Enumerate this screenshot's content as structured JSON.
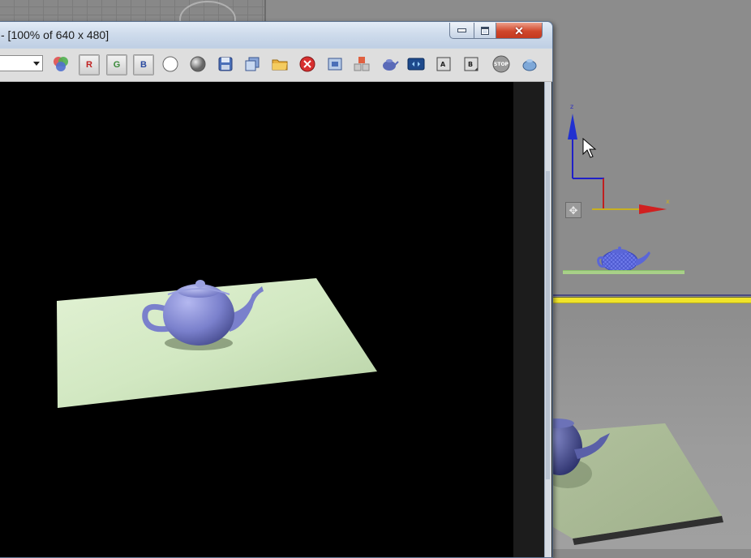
{
  "window": {
    "title": "- [100% of 640 x 480]"
  },
  "toolbar": {
    "channel_dropdown_value": "",
    "buttons": [
      {
        "name": "color-channels-icon",
        "label": ""
      },
      {
        "name": "red-channel-button",
        "label": "R"
      },
      {
        "name": "green-channel-button",
        "label": "G"
      },
      {
        "name": "blue-channel-button",
        "label": "B"
      },
      {
        "name": "white-circle-icon",
        "label": ""
      },
      {
        "name": "gray-sphere-icon",
        "label": ""
      },
      {
        "name": "save-icon",
        "label": ""
      },
      {
        "name": "clone-icon",
        "label": ""
      },
      {
        "name": "open-folder-icon",
        "label": ""
      },
      {
        "name": "clear-icon",
        "label": ""
      },
      {
        "name": "region-icon",
        "label": ""
      },
      {
        "name": "track-icon",
        "label": ""
      },
      {
        "name": "teapot-render-icon",
        "label": ""
      },
      {
        "name": "history-icon",
        "label": ""
      },
      {
        "name": "frame-a-icon",
        "label": ""
      },
      {
        "name": "frame-b-icon",
        "label": ""
      },
      {
        "name": "stop-button",
        "label": "STOP"
      },
      {
        "name": "preview-teapot-icon",
        "label": ""
      }
    ]
  },
  "gizmo": {
    "z_label": "z",
    "x_label": "x"
  },
  "colors": {
    "teapot": "#8a8fd8",
    "plane": "#d8ebcc",
    "window_frame": "#c4d3e6",
    "yellow_border": "#f0e42a",
    "close_button": "#d0472c"
  }
}
